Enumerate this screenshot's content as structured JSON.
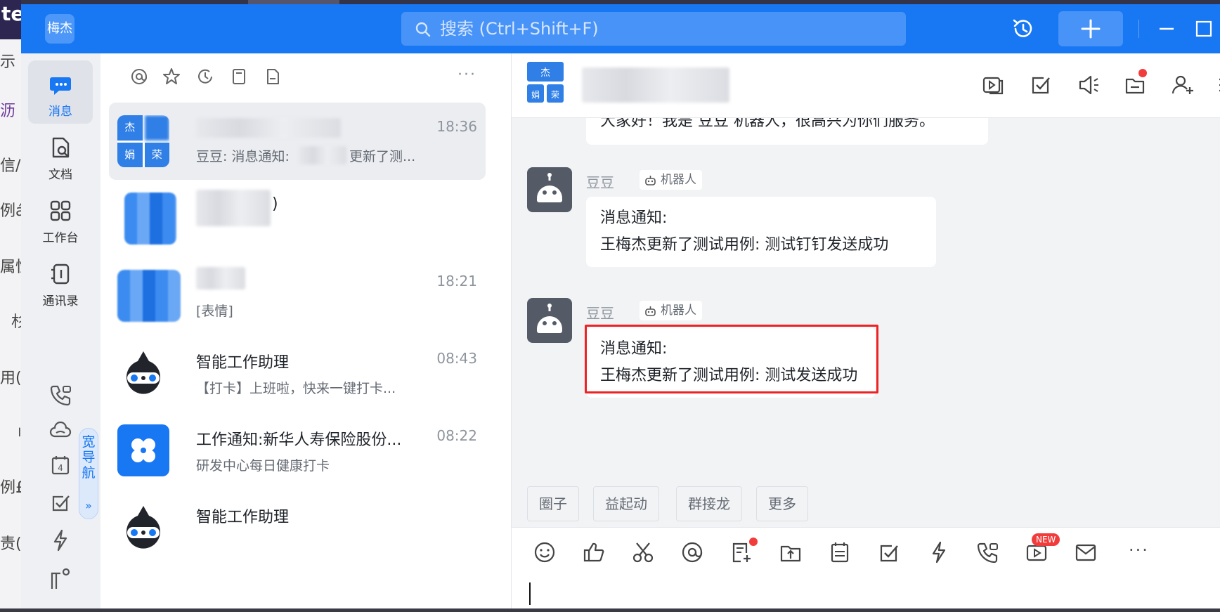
{
  "background_window": {
    "top_text": "te",
    "items": [
      "示",
      "沥",
      "信/",
      "例á",
      "属性",
      "杉",
      "用(",
      "刂",
      "例£",
      "责("
    ]
  },
  "titlebar": {
    "brand_label": "梅杰",
    "search_placeholder": "搜索 (Ctrl+Shift+F)",
    "icons": [
      "history-icon",
      "plus-icon",
      "minimize-icon",
      "maximize-icon"
    ]
  },
  "nav": {
    "items": [
      {
        "label": "消息",
        "icon": "message-icon",
        "active": true
      },
      {
        "label": "文档",
        "icon": "document-icon",
        "active": false
      },
      {
        "label": "工作台",
        "icon": "workbench-icon",
        "active": false
      },
      {
        "label": "通讯录",
        "icon": "contacts-icon",
        "active": false
      }
    ],
    "small_icons": [
      "phone-icon",
      "cloud-icon",
      "calendar-icon",
      "todo-icon",
      "flash-icon",
      "more-apps-icon"
    ],
    "calendar_day": "4",
    "wide_nav_label": "宽导航",
    "wide_nav_arrow": "»"
  },
  "conversation_list": {
    "filter_icons": [
      "mention-icon",
      "star-icon",
      "recent-icon",
      "bookmark-icon",
      "file-icon"
    ],
    "filter_more": "···",
    "items": [
      {
        "name": "",
        "time": "18:36",
        "preview_prefix": "豆豆: 消息通知:",
        "preview_suffix": "更新了测...",
        "avatar_chars": [
          "杰",
          "",
          "娟",
          "荣"
        ]
      },
      {
        "name": ")",
        "time": "",
        "preview": ""
      },
      {
        "name": "",
        "time": "18:21",
        "preview": "[表情]"
      },
      {
        "name": "智能工作助理",
        "time": "08:43",
        "preview": "【打卡】上班啦，快来一键打卡..."
      },
      {
        "name": "工作通知:新华人寿保险股份...",
        "time": "08:22",
        "preview": "研发中心每日健康打卡"
      },
      {
        "name": "智能工作助理",
        "time": "",
        "preview": ""
      }
    ]
  },
  "chat": {
    "header_avatar_chars": [
      "杰",
      "娟",
      "荣"
    ],
    "header_icons": [
      "live-icon",
      "task-icon",
      "announcement-icon",
      "minus-doc-icon",
      "add-member-icon",
      "search-chat-icon"
    ],
    "messages": [
      {
        "sender": "",
        "tag": "",
        "line1": "大家好！我是 豆豆 机器人，很高兴为你们服务。",
        "line2": ""
      },
      {
        "sender": "豆豆",
        "tag": "机器人",
        "line1": "消息通知:",
        "line2": "王梅杰更新了测试用例: 测试钉钉发送成功"
      },
      {
        "sender": "豆豆",
        "tag": "机器人",
        "line1": "消息通知:",
        "line2": "王梅杰更新了测试用例: 测试发送成功"
      }
    ],
    "quick_actions": [
      "圈子",
      "益起动",
      "群接龙",
      "更多"
    ],
    "composer_tools": [
      "emoji-icon",
      "thumbs-up-icon",
      "scissors-icon",
      "at-icon",
      "new-doc-icon",
      "upload-icon",
      "schedule-icon",
      "checklist-icon",
      "ding-icon",
      "call-icon",
      "video-icon",
      "mail-icon"
    ],
    "new_badge": "NEW",
    "more": "···",
    "colors": {
      "accent": "#1877f2",
      "highlight": "#ee2222",
      "chat_bg": "#f2f3f5"
    }
  }
}
